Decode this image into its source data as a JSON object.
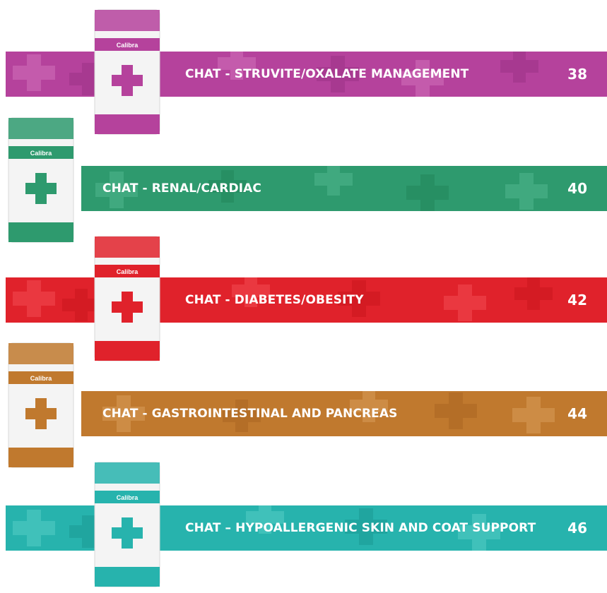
{
  "sections": [
    {
      "title": "CHAT - STRUVITE/OXALATE MANAGEMENT",
      "page": "38",
      "color": "#b5429c",
      "light": "#cf6db8",
      "dark": "#9a2f83"
    },
    {
      "title": "CHAT - RENAL/CARDIAC",
      "page": "40",
      "color": "#2e9a6e",
      "light": "#4db48a",
      "dark": "#1f8458"
    },
    {
      "title": "CHAT - DIABETES/OBESITY",
      "page": "42",
      "color": "#e0222b",
      "light": "#f0474f",
      "dark": "#c8141c"
    },
    {
      "title": "CHAT - GASTROINTESTINAL AND PANCREAS",
      "page": "44",
      "color": "#c0792e",
      "light": "#d69a55",
      "dark": "#a86320"
    },
    {
      "title": "CHAT – HYPOALLERGENIC SKIN AND COAT SUPPORT",
      "page": "46",
      "color": "#27b3ad",
      "light": "#52c9c3",
      "dark": "#1a9892"
    }
  ],
  "bag_brand": "Calibra"
}
